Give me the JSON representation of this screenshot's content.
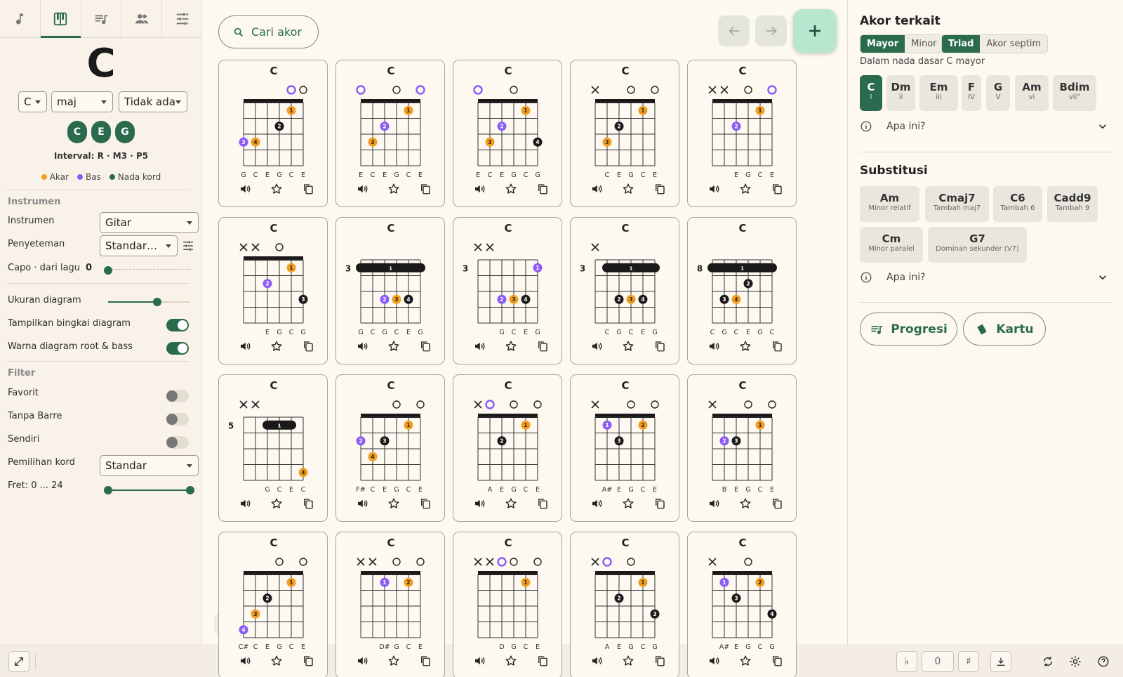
{
  "app": {
    "tabs": [
      {
        "name": "note-icon"
      },
      {
        "name": "piano-icon",
        "active": true
      },
      {
        "name": "playlist-icon"
      },
      {
        "name": "people-icon"
      },
      {
        "name": "tune-icon"
      }
    ],
    "colors": {
      "accent": "#2a6b4f",
      "root": "#f29d1e",
      "bass": "#8b5cf6",
      "chord_tone": "#1a1a1a",
      "add_button": "#b7e8cf"
    }
  },
  "chord": {
    "name": "C",
    "root_select": "C",
    "quality_select": "maj",
    "bass_select": "Tidak ada",
    "notes": [
      "C",
      "E",
      "G"
    ],
    "interval": "Interval: R · M3 · P5",
    "legend": {
      "root": "Akar",
      "bass": "Bas",
      "chord_tone": "Nada kord"
    }
  },
  "instrument_section": {
    "heading": "Instrumen",
    "instrument_label": "Instrumen",
    "instrument_value": "Gitar",
    "tuning_label": "Penyeteman",
    "tuning_value": "Standar…",
    "capo_label": "Capo · dari lagu",
    "capo_value": "0",
    "diagram_size_label": "Ukuran diagram",
    "diagram_size_level": 0.6,
    "show_frame_label": "Tampilkan bingkai diagram",
    "show_frame_on": true,
    "root_bass_color_label": "Warna diagram root & bass",
    "root_bass_color_on": true
  },
  "filter_section": {
    "heading": "Filter",
    "favorite_label": "Favorit",
    "no_barre_label": "Tanpa Barre",
    "own_label": "Sendiri",
    "voicing_label": "Pemilihan kord",
    "voicing_value": "Standar",
    "fret_label": "Fret: 0 ... 24",
    "fret_range": [
      0,
      24
    ]
  },
  "search": {
    "label": "Cari akor"
  },
  "cards": [
    {
      "title": "C",
      "base_fret": 1,
      "strings": [
        "",
        "",
        "",
        "",
        "B",
        "O"
      ],
      "dots": [
        [
          5,
          1,
          "1",
          "r"
        ],
        [
          4,
          2,
          "2",
          "c"
        ],
        [
          2,
          3,
          "4",
          "r"
        ],
        [
          1,
          3,
          "3",
          "b"
        ]
      ],
      "barre": null,
      "notes": [
        "G",
        "C",
        "E",
        "G",
        "C",
        "E"
      ]
    },
    {
      "title": "C",
      "base_fret": 1,
      "strings": [
        "B",
        "",
        "",
        "O",
        "",
        "B"
      ],
      "dots": [
        [
          5,
          1,
          "1",
          "r"
        ],
        [
          3,
          2,
          "2",
          "b"
        ],
        [
          2,
          3,
          "3",
          "r"
        ]
      ],
      "barre": null,
      "notes": [
        "E",
        "C",
        "E",
        "G",
        "C",
        "E"
      ]
    },
    {
      "title": "C",
      "base_fret": 1,
      "strings": [
        "B",
        "",
        "",
        "O",
        "",
        ""
      ],
      "dots": [
        [
          5,
          1,
          "1",
          "r"
        ],
        [
          3,
          2,
          "2",
          "b"
        ],
        [
          2,
          3,
          "3",
          "r"
        ],
        [
          6,
          3,
          "4",
          "c"
        ]
      ],
      "barre": null,
      "notes": [
        "E",
        "C",
        "E",
        "G",
        "C",
        "G"
      ]
    },
    {
      "title": "C",
      "base_fret": 1,
      "strings": [
        "X",
        "",
        "",
        "O",
        "",
        "O"
      ],
      "dots": [
        [
          5,
          1,
          "1",
          "r"
        ],
        [
          3,
          2,
          "2",
          "c"
        ],
        [
          2,
          3,
          "3",
          "r"
        ]
      ],
      "barre": null,
      "notes": [
        "",
        "C",
        "E",
        "G",
        "C",
        "E"
      ]
    },
    {
      "title": "C",
      "base_fret": 1,
      "strings": [
        "X",
        "X",
        "",
        "O",
        "",
        "B"
      ],
      "dots": [
        [
          5,
          1,
          "1",
          "r"
        ],
        [
          3,
          2,
          "2",
          "b"
        ]
      ],
      "barre": null,
      "notes": [
        "",
        "",
        "E",
        "G",
        "C",
        "E"
      ]
    },
    {
      "title": "C",
      "base_fret": 1,
      "strings": [
        "X",
        "X",
        "",
        "O",
        "",
        ""
      ],
      "dots": [
        [
          5,
          1,
          "1",
          "r"
        ],
        [
          3,
          2,
          "2",
          "b"
        ],
        [
          6,
          3,
          "3",
          "c"
        ]
      ],
      "barre": null,
      "notes": [
        "",
        "",
        "E",
        "G",
        "C",
        "G"
      ]
    },
    {
      "title": "C",
      "base_fret": 3,
      "strings": [
        "",
        "",
        "",
        "",
        "",
        ""
      ],
      "dots": [
        [
          3,
          3,
          "2",
          "b"
        ],
        [
          4,
          3,
          "3",
          "r"
        ],
        [
          5,
          3,
          "4",
          "c"
        ]
      ],
      "barre": [
        1,
        6,
        1
      ],
      "notes": [
        "G",
        "C",
        "G",
        "C",
        "E",
        "G"
      ]
    },
    {
      "title": "C",
      "base_fret": 3,
      "strings": [
        "X",
        "X",
        "",
        "",
        "",
        ""
      ],
      "dots": [
        [
          6,
          1,
          "1",
          "b"
        ],
        [
          3,
          3,
          "2",
          "b"
        ],
        [
          4,
          3,
          "3",
          "r"
        ],
        [
          5,
          3,
          "4",
          "c"
        ]
      ],
      "barre": null,
      "notes": [
        "",
        "",
        "G",
        "C",
        "E",
        "G"
      ]
    },
    {
      "title": "C",
      "base_fret": 3,
      "strings": [
        "X",
        "",
        "",
        "",
        "",
        ""
      ],
      "dots": [
        [
          3,
          3,
          "2",
          "c"
        ],
        [
          4,
          3,
          "3",
          "r"
        ],
        [
          5,
          3,
          "4",
          "c"
        ]
      ],
      "barre": [
        2,
        6,
        1
      ],
      "notes": [
        "",
        "C",
        "G",
        "C",
        "E",
        "G"
      ]
    },
    {
      "title": "C",
      "base_fret": 8,
      "strings": [
        "",
        "",
        "",
        "",
        "",
        ""
      ],
      "dots": [
        [
          4,
          2,
          "2",
          "c"
        ],
        [
          2,
          3,
          "3",
          "c"
        ],
        [
          3,
          3,
          "4",
          "r"
        ]
      ],
      "barre": [
        1,
        6,
        1
      ],
      "notes": [
        "C",
        "G",
        "C",
        "E",
        "G",
        "C"
      ]
    },
    {
      "title": "C",
      "base_fret": 5,
      "strings": [
        "X",
        "X",
        "",
        "",
        "",
        ""
      ],
      "dots": [
        [
          6,
          4,
          "4",
          "r"
        ]
      ],
      "barre": [
        3,
        5,
        1
      ],
      "notes": [
        "",
        "",
        "G",
        "C",
        "E",
        "C"
      ]
    },
    {
      "title": "C",
      "base_fret": 1,
      "strings": [
        "",
        "",
        "",
        "O",
        "",
        "O"
      ],
      "dots": [
        [
          5,
          1,
          "1",
          "r"
        ],
        [
          1,
          2,
          "2",
          "b"
        ],
        [
          3,
          2,
          "3",
          "c"
        ],
        [
          2,
          3,
          "4",
          "r"
        ]
      ],
      "barre": null,
      "notes": [
        "F#",
        "C",
        "E",
        "G",
        "C",
        "E"
      ]
    },
    {
      "title": "C",
      "base_fret": 1,
      "strings": [
        "X",
        "B",
        "",
        "O",
        "",
        "O"
      ],
      "dots": [
        [
          5,
          1,
          "1",
          "r"
        ],
        [
          3,
          2,
          "2",
          "c"
        ]
      ],
      "barre": null,
      "notes": [
        "",
        "A",
        "E",
        "G",
        "C",
        "E"
      ]
    },
    {
      "title": "C",
      "base_fret": 1,
      "strings": [
        "X",
        "",
        "",
        "O",
        "",
        "O"
      ],
      "dots": [
        [
          2,
          1,
          "1",
          "b"
        ],
        [
          5,
          1,
          "2",
          "r"
        ],
        [
          3,
          2,
          "3",
          "c"
        ]
      ],
      "barre": null,
      "notes": [
        "",
        "A#",
        "E",
        "G",
        "C",
        "E"
      ]
    },
    {
      "title": "C",
      "base_fret": 1,
      "strings": [
        "X",
        "",
        "",
        "O",
        "",
        "O"
      ],
      "dots": [
        [
          5,
          1,
          "1",
          "r"
        ],
        [
          2,
          2,
          "2",
          "b"
        ],
        [
          3,
          2,
          "3",
          "c"
        ]
      ],
      "barre": null,
      "notes": [
        "",
        "B",
        "E",
        "G",
        "C",
        "E"
      ]
    },
    {
      "title": "C",
      "base_fret": 1,
      "strings": [
        "",
        "",
        "",
        "O",
        "",
        "O"
      ],
      "dots": [
        [
          5,
          1,
          "1",
          "r"
        ],
        [
          3,
          2,
          "2",
          "c"
        ],
        [
          2,
          3,
          "3",
          "r"
        ],
        [
          1,
          4,
          "4",
          "b"
        ]
      ],
      "barre": null,
      "notes": [
        "C#",
        "C",
        "E",
        "G",
        "C",
        "E"
      ]
    },
    {
      "title": "C",
      "base_fret": 1,
      "strings": [
        "X",
        "X",
        "",
        "O",
        "",
        "O"
      ],
      "dots": [
        [
          3,
          1,
          "1",
          "b"
        ],
        [
          5,
          1,
          "2",
          "r"
        ]
      ],
      "barre": null,
      "notes": [
        "",
        "",
        "D#",
        "G",
        "C",
        "E"
      ]
    },
    {
      "title": "C",
      "base_fret": 1,
      "strings": [
        "X",
        "X",
        "B",
        "O",
        "",
        "O"
      ],
      "dots": [
        [
          5,
          1,
          "1",
          "r"
        ]
      ],
      "barre": null,
      "notes": [
        "",
        "",
        "D",
        "G",
        "C",
        "E"
      ]
    },
    {
      "title": "C",
      "base_fret": 1,
      "strings": [
        "X",
        "B",
        "",
        "O",
        "",
        ""
      ],
      "dots": [
        [
          5,
          1,
          "1",
          "r"
        ],
        [
          3,
          2,
          "2",
          "c"
        ],
        [
          6,
          3,
          "3",
          "c"
        ]
      ],
      "barre": null,
      "notes": [
        "",
        "A",
        "E",
        "G",
        "C",
        "G"
      ]
    },
    {
      "title": "C",
      "base_fret": 1,
      "strings": [
        "X",
        "",
        "",
        "O",
        "",
        ""
      ],
      "dots": [
        [
          2,
          1,
          "1",
          "b"
        ],
        [
          5,
          1,
          "2",
          "r"
        ],
        [
          3,
          2,
          "3",
          "c"
        ],
        [
          6,
          3,
          "4",
          "c"
        ]
      ],
      "barre": null,
      "notes": [
        "",
        "A#",
        "E",
        "G",
        "C",
        "G"
      ]
    }
  ],
  "right": {
    "related_title": "Akor terkait",
    "seg1": [
      "Mayor",
      "Minor"
    ],
    "seg2": [
      "Triad",
      "Akor septim"
    ],
    "key_caption": "Dalam nada dasar C mayor",
    "related_chords": [
      {
        "name": "C",
        "degree": "I",
        "active": true
      },
      {
        "name": "Dm",
        "degree": "ii"
      },
      {
        "name": "Em",
        "degree": "iii"
      },
      {
        "name": "F",
        "degree": "IV"
      },
      {
        "name": "G",
        "degree": "V"
      },
      {
        "name": "Am",
        "degree": "vi"
      },
      {
        "name": "Bdim",
        "degree": "vii°"
      }
    ],
    "what_is_this": "Apa ini?",
    "subst_title": "Substitusi",
    "substitutions": [
      {
        "name": "Am",
        "desc": "Minor relatif"
      },
      {
        "name": "Cmaj7",
        "desc": "Tambah maj7"
      },
      {
        "name": "C6",
        "desc": "Tambah 6"
      },
      {
        "name": "Cadd9",
        "desc": "Tambah 9"
      },
      {
        "name": "Cm",
        "desc": "Minor paralel"
      },
      {
        "name": "G7",
        "desc": "Dominan sekunder (V7)"
      }
    ],
    "progression_label": "Progresi",
    "cards_label": "Kartu"
  },
  "bottom": {
    "flat": "♭",
    "transpose_value": "0",
    "sharp": "♯"
  }
}
